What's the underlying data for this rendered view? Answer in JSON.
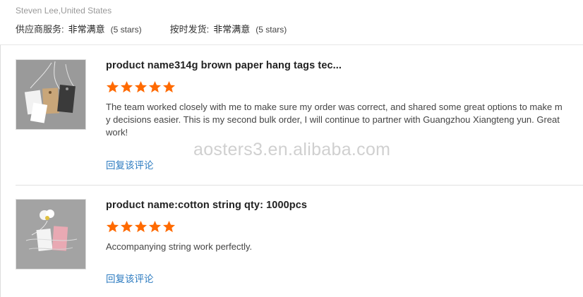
{
  "header": {
    "reviewer": "Steven Lee,United States",
    "ratings": [
      {
        "label": "供应商服务:",
        "value": "非常满意",
        "stars_text": "(5 stars)"
      },
      {
        "label": "按时发货:",
        "value": "非常满意",
        "stars_text": "(5 stars)"
      }
    ]
  },
  "reviews": [
    {
      "product_name": "product name314g brown paper hang tags tec...",
      "stars": 5,
      "text": "The team worked closely with me to make sure my order was correct, and shared some great options to make my decisions easier. This is my second bulk order, I will continue to partner with Guangzhou Xiangteng yun. Great work!",
      "reply_label": "回复该评论"
    },
    {
      "product_name": "product name:cotton string qty: 1000pcs",
      "stars": 5,
      "text": "Accompanying string work perfectly.",
      "reply_label": "回复该评论"
    }
  ],
  "watermark": "aosters3.en.alibaba.com",
  "colors": {
    "star": "#ff6a00",
    "link": "#2c7bc0",
    "muted": "#999999"
  }
}
